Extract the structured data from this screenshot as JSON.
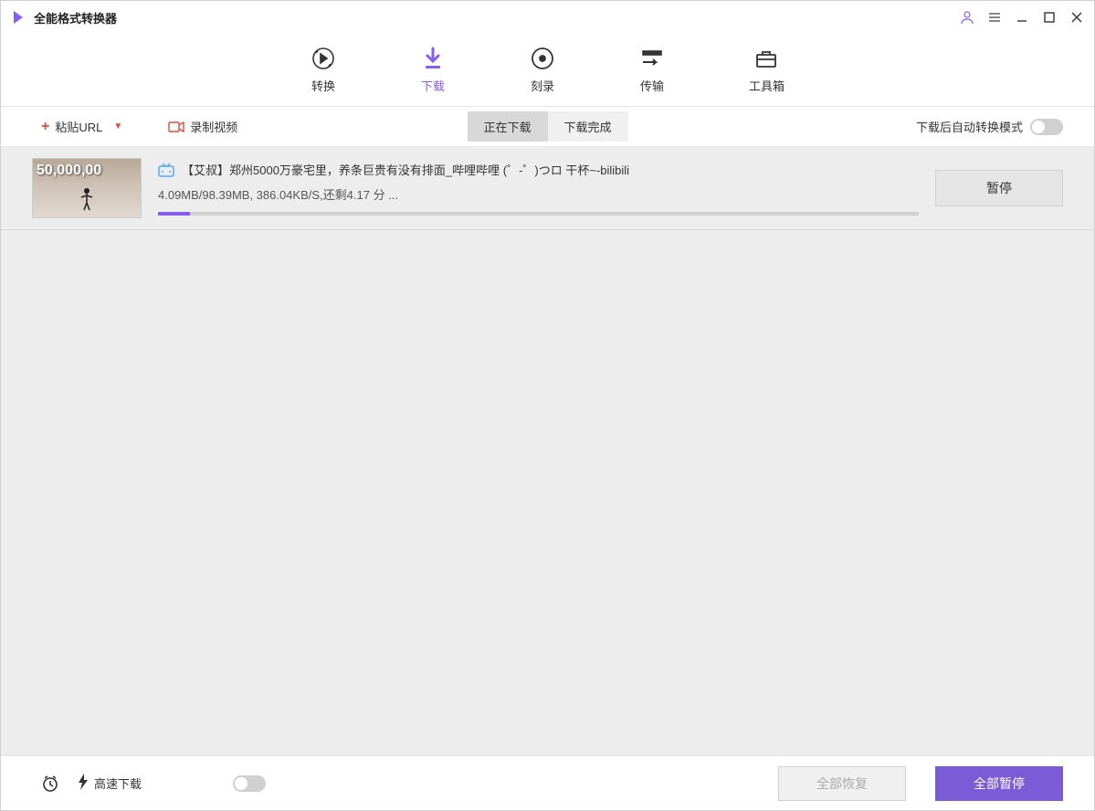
{
  "titlebar": {
    "title": "全能格式转换器"
  },
  "mainTabs": {
    "convert": "转换",
    "download": "下载",
    "burn": "刻录",
    "transfer": "传输",
    "toolbox": "工具箱"
  },
  "actionBar": {
    "pasteUrl": "粘贴URL",
    "record": "录制视频",
    "subTabs": {
      "downloading": "正在下载",
      "completed": "下载完成"
    },
    "autoConvertLabel": "下载后自动转换模式"
  },
  "downloads": [
    {
      "thumbText": "50,000,00",
      "title": "【艾叔】郑州5000万豪宅里，养条巨贵有没有排面_哔哩哔哩 (゜-゜)つロ 干杯~-bilibili",
      "status": "4.09MB/98.39MB, 386.04KB/S,还剩4.17 分 ...",
      "progressPercent": 4.2,
      "pauseLabel": "暂停"
    }
  ],
  "footer": {
    "speedLabel": "高速下载",
    "resumeAll": "全部恢复",
    "pauseAll": "全部暂停"
  }
}
